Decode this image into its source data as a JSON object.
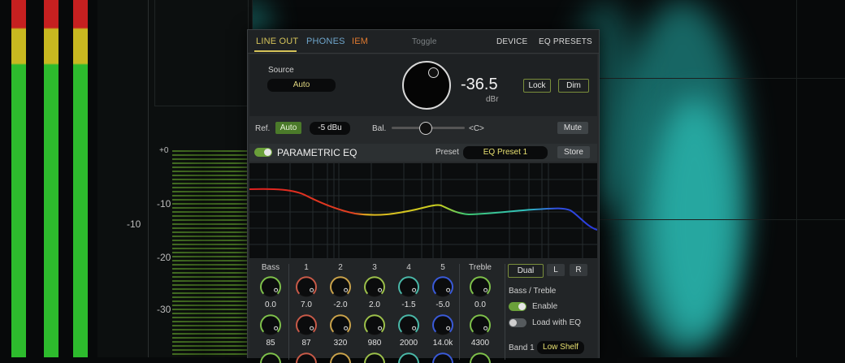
{
  "window": {
    "tabs": [
      {
        "label": "LINE OUT",
        "color": "#d4c35a",
        "active": true
      },
      {
        "label": "PHONES",
        "color": "#6fa6cc"
      },
      {
        "label": "IEM",
        "color": "#e07a2f"
      }
    ],
    "toggle_label": "Toggle",
    "right_tabs": [
      "DEVICE",
      "EQ PRESETS"
    ]
  },
  "monitor": {
    "source_label": "Source",
    "source_value": "Auto",
    "volume_value": "-36.5",
    "volume_unit": "dBr",
    "lock_label": "Lock",
    "dim_label": "Dim",
    "ref_label": "Ref.",
    "ref_mode": "Auto",
    "ref_level": "-5 dBu",
    "balance_label": "Bal.",
    "balance_value": "<C>",
    "mute_label": "Mute"
  },
  "eq": {
    "title": "PARAMETRIC EQ",
    "enabled": true,
    "preset_label": "Preset",
    "preset_value": "EQ Preset 1",
    "store_label": "Store",
    "bands": [
      {
        "name": "Bass",
        "gain": "0.0",
        "freq": "85",
        "color": "#7ec04a"
      },
      {
        "name": "1",
        "gain": "7.0",
        "freq": "87",
        "color": "#c85a48"
      },
      {
        "name": "2",
        "gain": "-2.0",
        "freq": "320",
        "color": "#c9a24a"
      },
      {
        "name": "3",
        "gain": "2.0",
        "freq": "980",
        "color": "#9cc04a"
      },
      {
        "name": "4",
        "gain": "-1.5",
        "freq": "2000",
        "color": "#4ab8a8"
      },
      {
        "name": "5",
        "gain": "-5.0",
        "freq": "14.0k",
        "color": "#3a5ad8"
      },
      {
        "name": "Treble",
        "gain": "0.0",
        "freq": "4300",
        "color": "#7ec04a"
      }
    ],
    "channel_buttons": [
      "Dual",
      "L",
      "R"
    ],
    "bass_treble_label": "Bass / Treble",
    "enable_label": "Enable",
    "load_with_eq_label": "Load with EQ",
    "band1_label": "Band 1",
    "band1_type": "Low Shelf"
  },
  "background": {
    "scale_labels": [
      "+0",
      "-10",
      "-10",
      "-20",
      "-30"
    ]
  },
  "colors": {
    "accent_green": "#6aa03a",
    "accent_yellow": "#d4c35a",
    "curve_red": "#e02020",
    "curve_blue": "#2a3ae0"
  }
}
